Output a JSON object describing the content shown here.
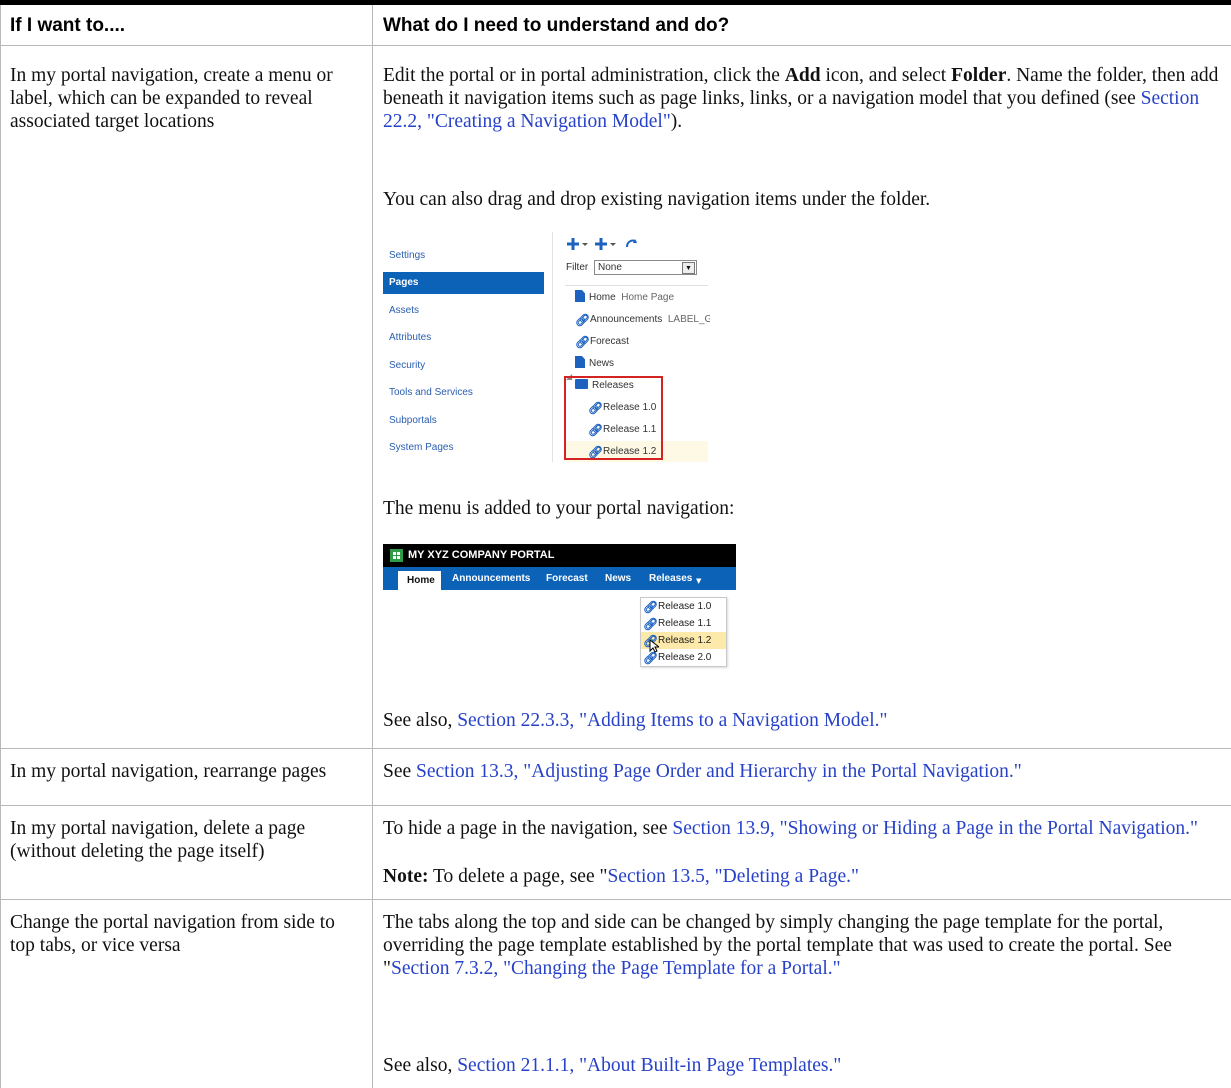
{
  "table": {
    "header": {
      "col1": "If I want to....",
      "col2": "What do I need to understand and do?"
    },
    "row1": {
      "want": "In my portal navigation, create a menu or label, which can be expanded to reveal associated target locations",
      "p1_a": "Edit the portal or in portal administration, click the ",
      "p1_add": "Add",
      "p1_b": " icon, and select ",
      "p1_folder": "Folder",
      "p1_c": ". Name the folder, then add beneath it navigation items such as page links, links, or a navigation model that you defined (see ",
      "p1_link": "Section 22.2, \"Creating a Navigation Model\"",
      "p1_d": ").",
      "p2": "You can also drag and drop existing navigation items under the folder.",
      "p3": "The menu is added to your portal navigation:",
      "p4_a": "See also, ",
      "p4_link": "Section 22.3.3, \"Adding Items to a Navigation Model.\""
    },
    "row2": {
      "want": "In my portal navigation, rearrange pages",
      "a": "See ",
      "link": "Section 13.3, \"Adjusting Page Order and Hierarchy in the Portal Navigation.\""
    },
    "row3": {
      "want": "In my portal navigation, delete a page (without deleting the page itself)",
      "p1_a": "To hide a page in the navigation, see ",
      "p1_link": "Section 13.9, \"Showing or Hiding a Page in the Portal Navigation.\"",
      "p2_note": "Note:",
      "p2_a": " To delete a page, see \"",
      "p2_link": "Section 13.5, \"Deleting a Page.\""
    },
    "row4": {
      "want": "Change the portal navigation from side to top tabs, or vice versa",
      "p1_a": "The tabs along the top and side can be changed by simply changing the page template for the portal, overriding the page template established by the portal template that was used to create the portal. See \"",
      "p1_link": "Section 7.3.2, \"Changing the Page Template for a Portal.\"",
      "p2_a": "See also, ",
      "p2_link": "Section 21.1.1, \"About Built-in Page Templates.\""
    }
  },
  "admin_screenshot": {
    "sidebar": [
      "Settings",
      "Pages",
      "Assets",
      "Attributes",
      "Security",
      "Tools and Services",
      "Subportals",
      "System Pages"
    ],
    "selected": "Pages",
    "toolbar_icons": [
      "add-page-icon",
      "add-item-icon",
      "refresh-icon"
    ],
    "filter_label": "Filter",
    "filter_value": "None",
    "tree": [
      {
        "icon": "page-icon",
        "label": "Home",
        "extra": "Home Page"
      },
      {
        "icon": "link-icon",
        "label": "Announcements",
        "extra": "LABEL_G"
      },
      {
        "icon": "link-icon",
        "label": "Forecast",
        "extra": ""
      },
      {
        "icon": "page-icon",
        "label": "News",
        "extra": ""
      },
      {
        "icon": "folder-icon",
        "label": "Releases",
        "extra": ""
      },
      {
        "icon": "link-icon",
        "label": "Release 1.0",
        "extra": ""
      },
      {
        "icon": "link-icon",
        "label": "Release 1.1",
        "extra": ""
      },
      {
        "icon": "link-icon",
        "label": "Release 1.2",
        "extra": ""
      }
    ]
  },
  "nav_screenshot": {
    "portal_title": "MY XYZ COMPANY PORTAL",
    "tabs": [
      "Home",
      "Announcements",
      "Forecast",
      "News",
      "Releases"
    ],
    "menu": [
      "Release 1.0",
      "Release 1.1",
      "Release 1.2",
      "Release 2.0"
    ],
    "highlight_color": "#fde9a9"
  }
}
